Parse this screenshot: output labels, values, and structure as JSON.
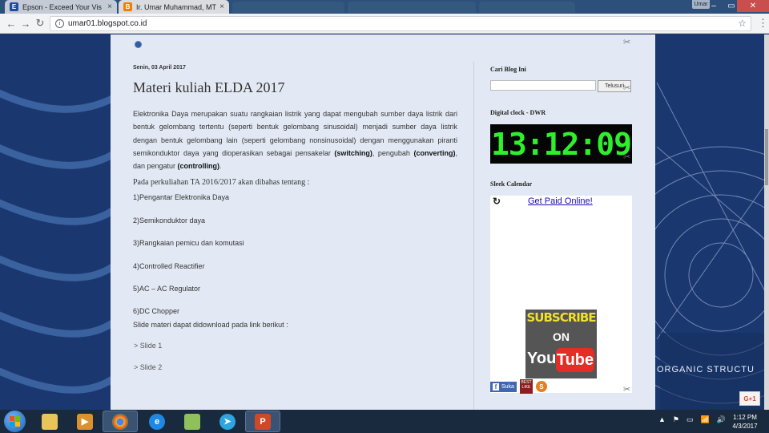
{
  "browser": {
    "tabs": [
      {
        "icon": "E",
        "title": "Epson - Exceed Your Vis",
        "close": "×",
        "active": false
      },
      {
        "icon": "B",
        "title": "Ir. Umar Muhammad, MT",
        "close": "×",
        "active": true
      }
    ],
    "profile": "Umar",
    "window_controls": {
      "minimize": "–",
      "maximize": "▭",
      "close": "✕"
    },
    "nav": {
      "back": "←",
      "forward": "→",
      "reload": "↻"
    },
    "url": "umar01.blogspot.co.id",
    "info": "i",
    "star": "☆",
    "menu": "⋮"
  },
  "post": {
    "date": "Senin, 03 April 2017",
    "title": "Materi kuliah ELDA 2017",
    "intro_parts": [
      "Elektronika Daya merupakan suatu rangkaian listrik yang dapat mengubah sumber daya listrik dari bentuk gelombang tertentu (seperti bentuk gelombang sinusoidal) menjadi sumber daya listrik dengan bentuk gelombang lain (seperti gelombang nonsinusoidal) dengan menggunakan piranti semikonduktor daya yang dioperasikan sebagai pensakelar ",
      "(switching)",
      ", pengubah ",
      "(converting)",
      ", dan pengatur ",
      "(controlling)",
      "."
    ],
    "topics_intro": "Pada perkuliahan TA 2016/2017 akan dibahas tentang :",
    "topics": [
      "1)Pengantar Elektronika Daya",
      "2)Semikonduktor daya",
      "3)Rangkaian pemicu dan komutasi",
      "4)Controlled Reactifier",
      "5)AC – AC Regulator",
      "6)DC Chopper"
    ],
    "slides_intro": "Slide materi dapat didownload pada link berikut :",
    "slides": [
      "> Slide 1",
      "> Slide 2"
    ]
  },
  "sidebar": {
    "search_title": "Cari Blog Ini",
    "search_button": "Telusuri",
    "clock_title": "Digital clock - DWR",
    "clock_time": "13:12:09",
    "calendar_title": "Sleek Calendar",
    "calendar_refresh": "↻",
    "calendar_link": "Get Paid Online!",
    "youtube": {
      "line1": "SUBSCRIBE",
      "line2": "ON",
      "you": "You",
      "tube": "Tube"
    },
    "fb_like": "Suka",
    "like_badge": "BEST LIKE",
    "share": "S"
  },
  "background": {
    "overlay_text": "ORGANIC STRUCTU"
  },
  "gplus": "G+1",
  "taskbar": {
    "time": "1:12 PM",
    "date": "4/3/2017",
    "tray_icons": [
      "▲",
      "⚑",
      "▭",
      "📶",
      "🔊"
    ]
  },
  "colors": {
    "clock_green": "#2df02a",
    "youtube_red": "#e52d27",
    "subscribe_yellow": "#f2e02b",
    "blog_bg": "#e3e9f4"
  }
}
